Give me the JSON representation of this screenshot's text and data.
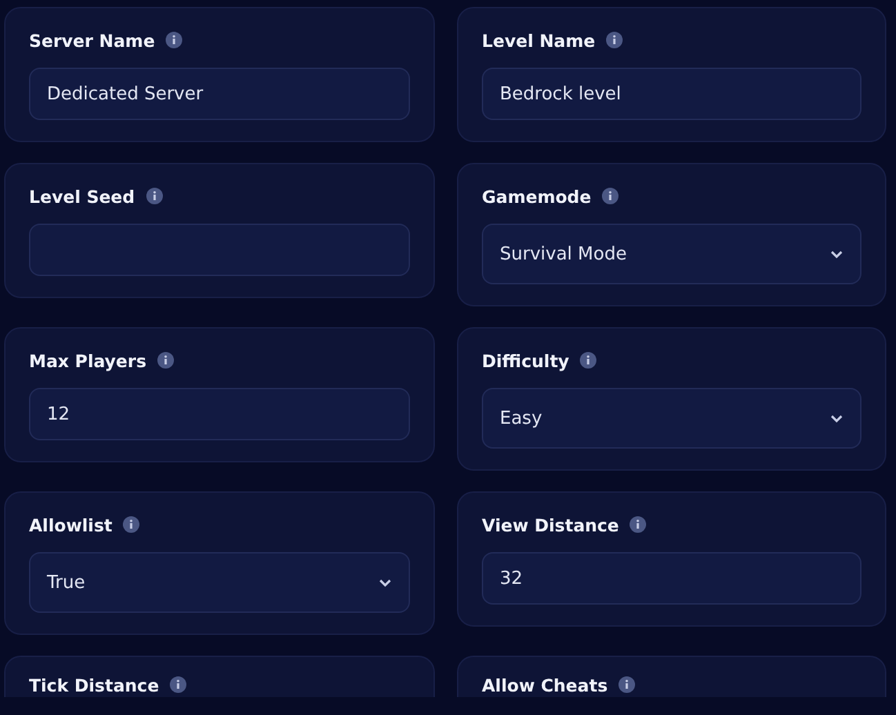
{
  "settings": [
    {
      "label": "Server Name",
      "kind": "text",
      "value": "Dedicated Server"
    },
    {
      "label": "Level Name",
      "kind": "text",
      "value": "Bedrock level"
    },
    {
      "label": "Level Seed",
      "kind": "text"
    },
    {
      "label": "Gamemode",
      "kind": "select",
      "value": "Survival Mode"
    },
    {
      "label": "Max Players",
      "kind": "text",
      "value": "12"
    },
    {
      "label": "Difficulty",
      "kind": "select",
      "value": "Easy"
    },
    {
      "label": "Allowlist",
      "kind": "select",
      "value": "True"
    },
    {
      "label": "View Distance",
      "kind": "text",
      "value": "32"
    },
    {
      "label": "Tick Distance",
      "kind": "cut"
    },
    {
      "label": "Allow Cheats",
      "kind": "cut"
    }
  ]
}
